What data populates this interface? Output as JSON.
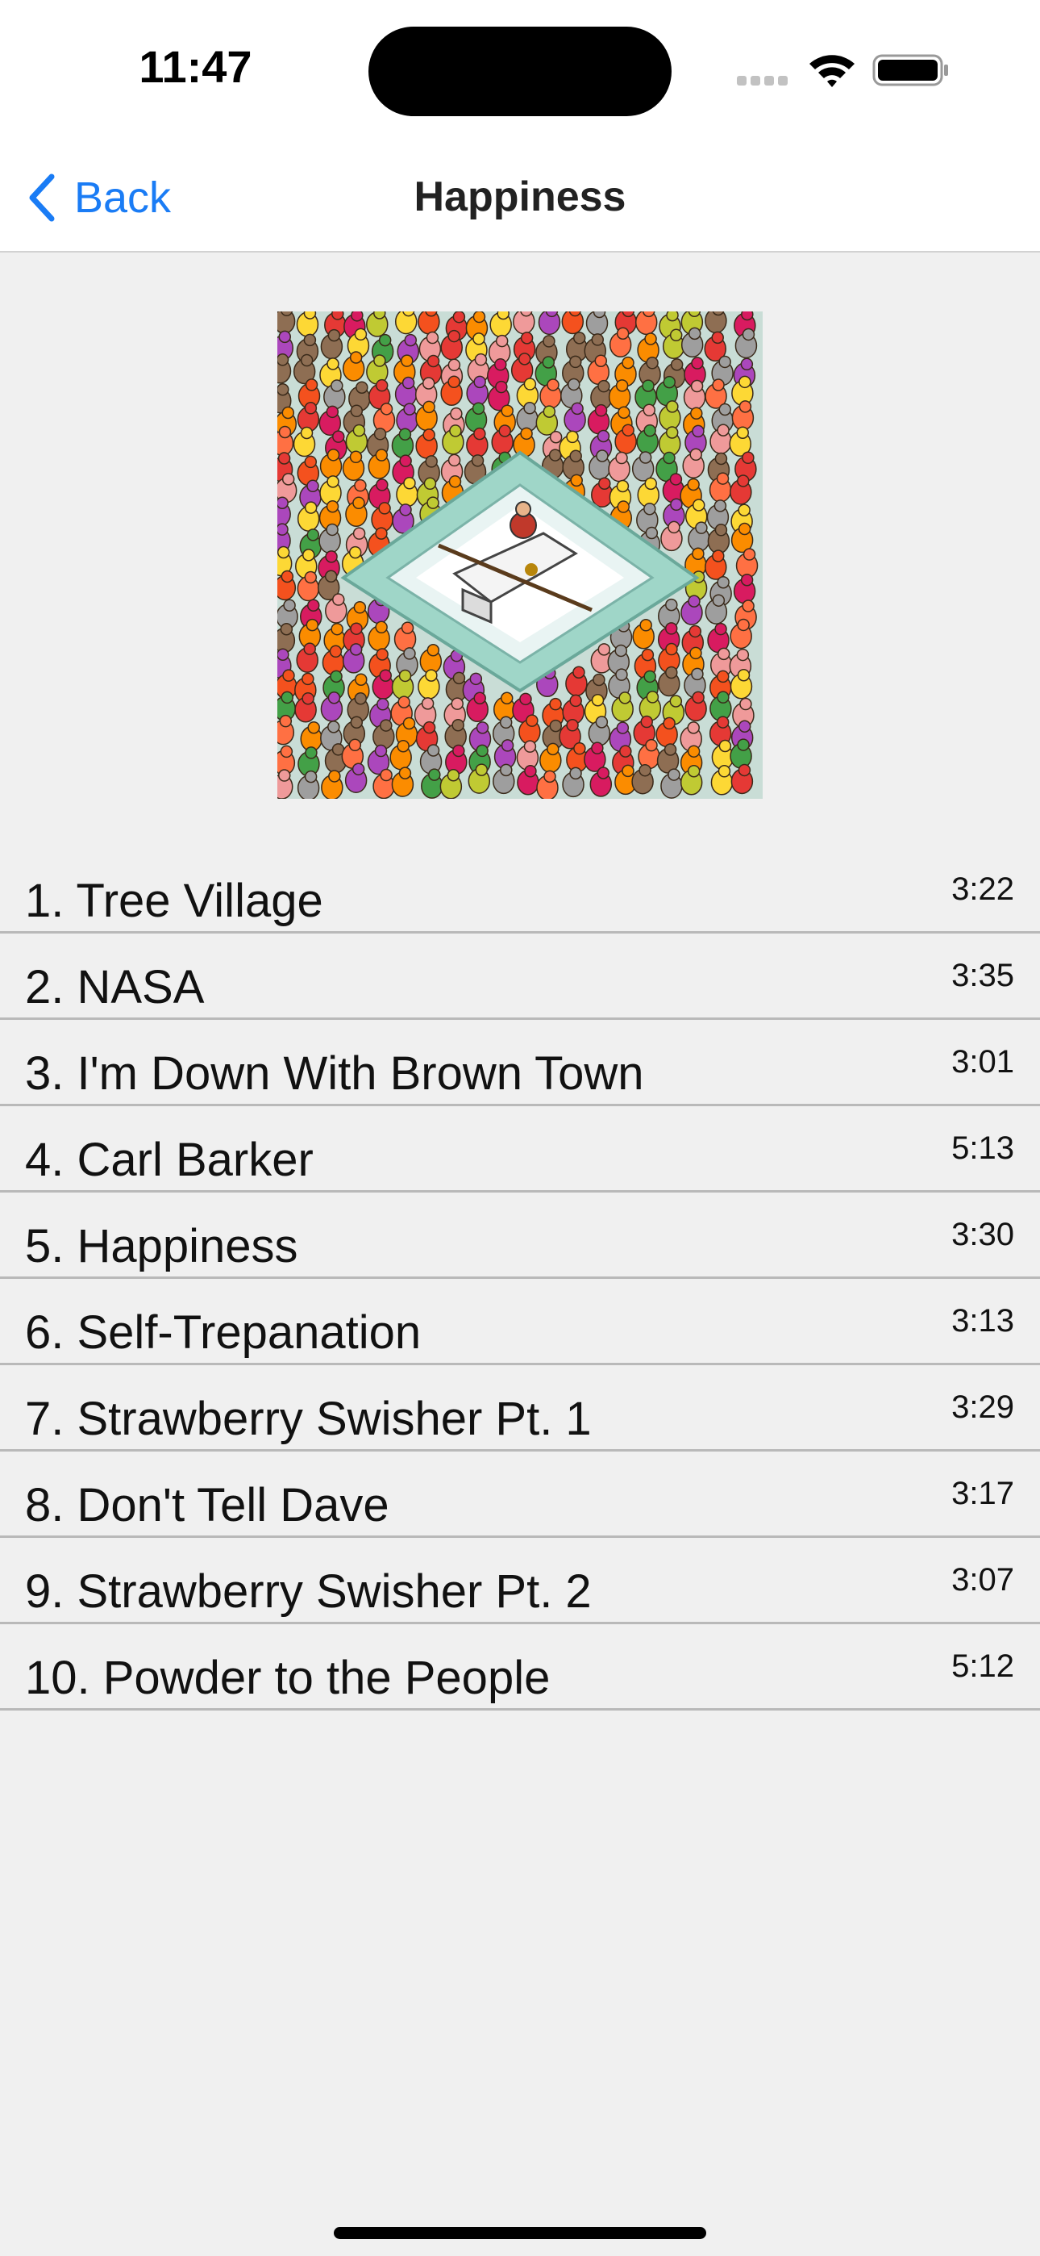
{
  "status_bar": {
    "time": "11:47",
    "icons": [
      "cellular-signal-icon",
      "wifi-icon",
      "battery-icon"
    ]
  },
  "nav": {
    "back_label": "Back",
    "title": "Happiness",
    "accent_color": "#1a7cf5"
  },
  "album": {
    "cover_icon": "album-artwork"
  },
  "tracks": [
    {
      "title": "1. Tree Village",
      "duration": "3:22"
    },
    {
      "title": "2. NASA",
      "duration": "3:35"
    },
    {
      "title": "3. I'm Down With Brown Town",
      "duration": "3:01"
    },
    {
      "title": "4. Carl Barker",
      "duration": "5:13"
    },
    {
      "title": "5. Happiness",
      "duration": "3:30"
    },
    {
      "title": "6. Self-Trepanation",
      "duration": "3:13"
    },
    {
      "title": "7. Strawberry Swisher Pt. 1",
      "duration": "3:29"
    },
    {
      "title": "8. Don't Tell Dave",
      "duration": "3:17"
    },
    {
      "title": "9. Strawberry Swisher Pt. 2",
      "duration": "3:07"
    },
    {
      "title": "10. Powder to the People",
      "duration": "5:12"
    }
  ]
}
